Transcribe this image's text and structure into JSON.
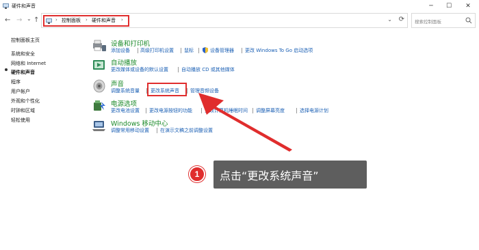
{
  "window": {
    "title": "硬件和声音",
    "min_glyph": "─",
    "max_glyph": "☐",
    "close_glyph": "✕"
  },
  "nav": {
    "back_glyph": "←",
    "forward_glyph": "→",
    "dropdown_glyph": "⌄",
    "up_glyph": "↑"
  },
  "address": {
    "crumb1": "控制面板",
    "crumb2": "硬件和声音",
    "sep": "›",
    "refresh_glyph": "⟳",
    "dropdown_glyph": "⌄"
  },
  "search": {
    "placeholder": "搜索控制面板"
  },
  "sidebar": {
    "items": [
      {
        "label": "控制面板主页"
      },
      {
        "label": "系统和安全"
      },
      {
        "label": "网络和 Internet"
      },
      {
        "label": "硬件和声音"
      },
      {
        "label": "程序"
      },
      {
        "label": "用户帐户"
      },
      {
        "label": "外观和个性化"
      },
      {
        "label": "时钟和区域"
      },
      {
        "label": "轻松使用"
      }
    ]
  },
  "categories": {
    "devices": {
      "title": "设备和打印机",
      "links": [
        "添加设备",
        "高级打印机设置",
        "鼠标",
        "设备管理器",
        "更改 Windows To Go 启动选项"
      ]
    },
    "autoplay": {
      "title": "自动播放",
      "links": [
        "更改媒体或设备的默认设置",
        "自动播放 CD 或其他媒体"
      ]
    },
    "sound": {
      "title": "声音",
      "links": [
        "调整系统音量",
        "更改系统声音",
        "管理音频设备"
      ]
    },
    "power": {
      "title": "电源选项",
      "links": [
        "更改电池设置",
        "更改电源按钮的功能",
        "更改计算机睡眠时间",
        "调整屏幕亮度",
        "选择电源计划"
      ]
    },
    "mobility": {
      "title": "Windows 移动中心",
      "links": [
        "调整常用移动设置",
        "在演示文稿之前调整设置"
      ]
    }
  },
  "annotation": {
    "step": "1",
    "text": "点击“更改系统声音”"
  },
  "colors": {
    "accent_red": "#e02d2d",
    "category_green": "#1c8a2a",
    "link_blue": "#1a5fb4",
    "callout_bg": "#5e5e5e"
  }
}
